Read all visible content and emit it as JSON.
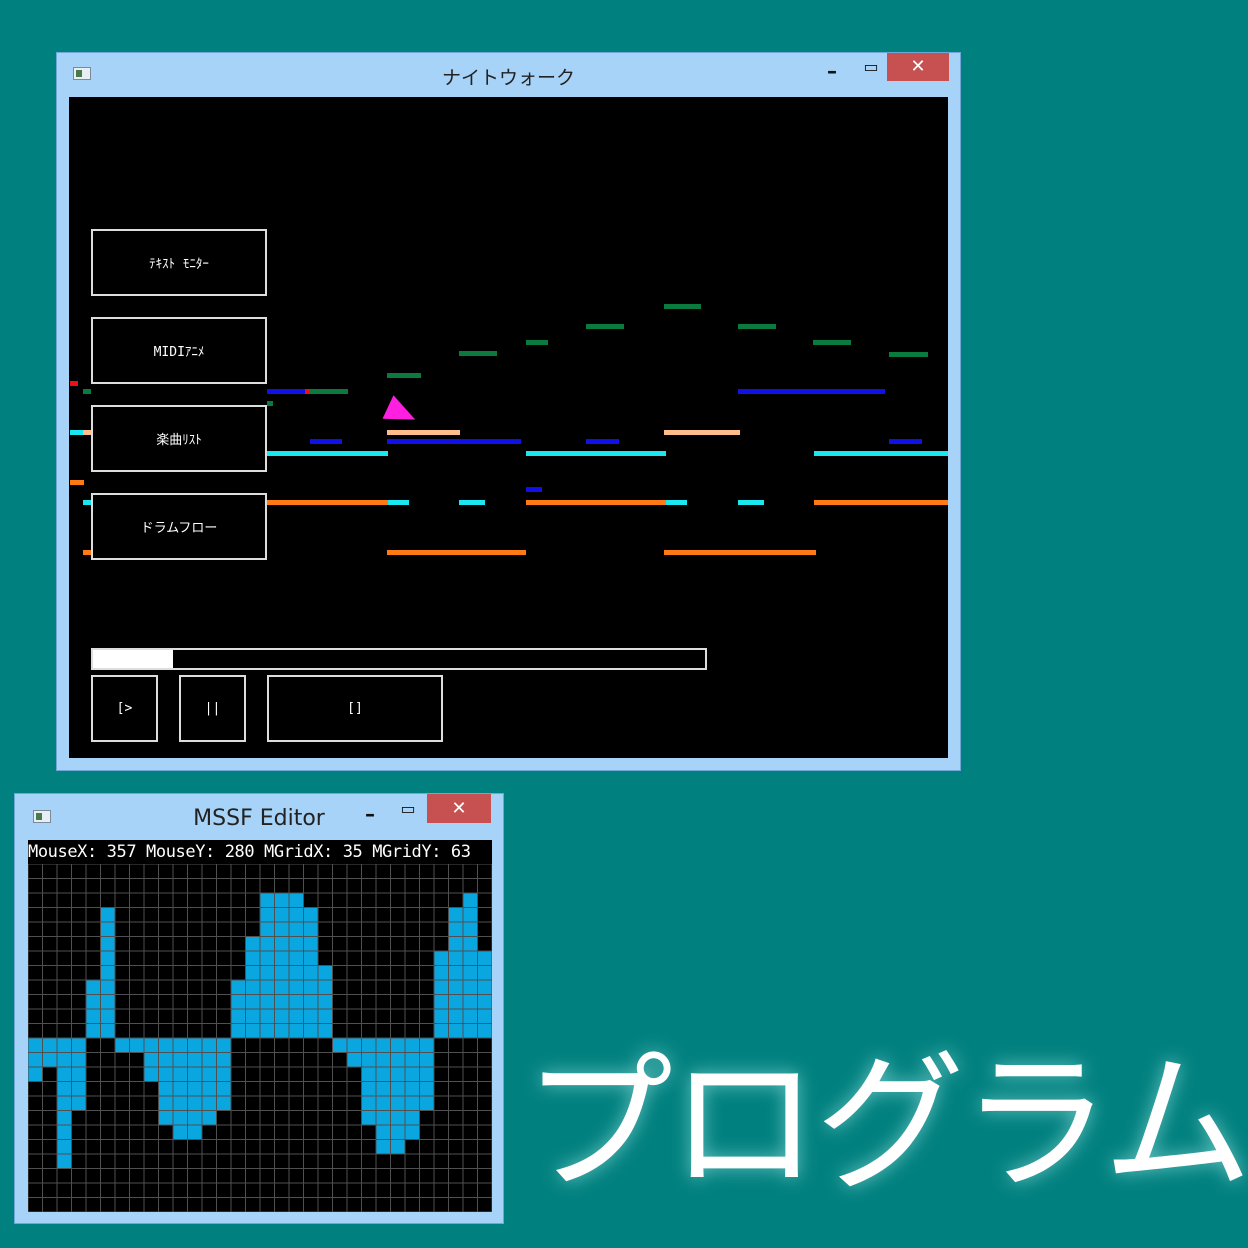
{
  "main_window": {
    "title": "ナイトウォーク",
    "min_glyph": "–",
    "max_glyph": "▭",
    "close_glyph": "✕",
    "menu_buttons": [
      "ﾃｷｽﾄ ﾓﾆﾀｰ",
      "MIDIｱﾆﾒ",
      "楽曲ﾘｽﾄ",
      "ドラムフロー"
    ],
    "playback": {
      "play_label": "[>",
      "pause_label": "||",
      "stop_label": "[]",
      "progress": 0.13
    },
    "colors": {
      "dark_green": "#0a7a3e",
      "blue": "#1010e8",
      "cyan": "#19e8f0",
      "peach": "#ffbd8c",
      "orange": "#ff7a12",
      "red": "#ee1010",
      "cursor": "#ff1fe0"
    }
  },
  "editor_window": {
    "title": "MSSF Editor",
    "min_glyph": "–",
    "max_glyph": "▭",
    "close_glyph": "✕",
    "status": "MouseX: 357 MouseY: 280 MGridX: 35 MGridY: 63",
    "grid": {
      "columns": 32,
      "rows": 24,
      "cell_color": "#0aa6e0",
      "line_color": "#505050"
    },
    "waveform": [
      -3,
      -2,
      -9,
      -5,
      4,
      9,
      -1,
      -1,
      -3,
      -6,
      -7,
      -7,
      -6,
      -5,
      4,
      7,
      10,
      10,
      10,
      9,
      5,
      -1,
      -2,
      -6,
      -8,
      -8,
      -7,
      -5,
      6,
      9,
      10,
      6
    ]
  },
  "caption": "プログラム"
}
